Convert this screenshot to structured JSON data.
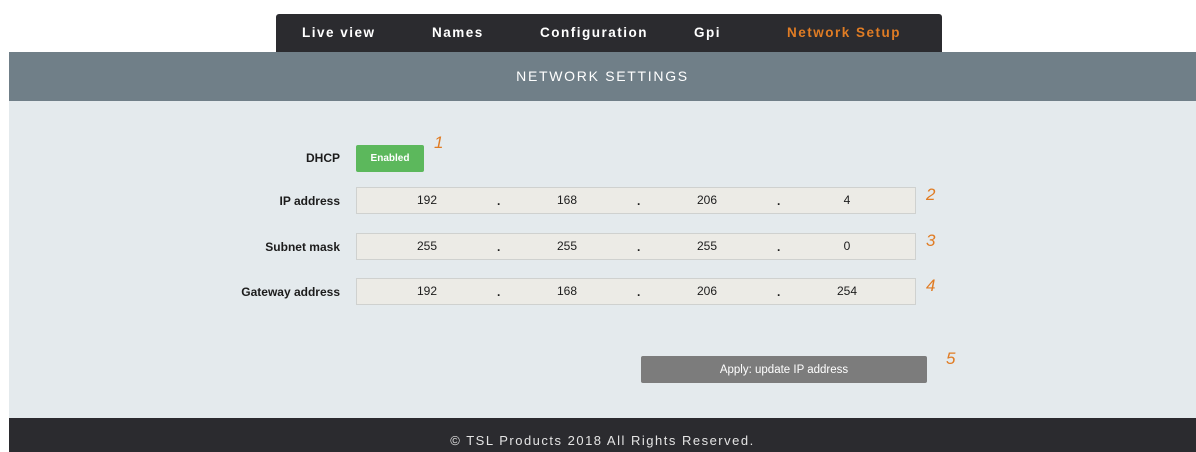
{
  "nav": {
    "tabs": [
      {
        "label": "Live view"
      },
      {
        "label": "Names"
      },
      {
        "label": "Configuration"
      },
      {
        "label": "Gpi"
      },
      {
        "label": "Network Setup"
      }
    ],
    "active_tab": "Network Setup"
  },
  "header": {
    "title": "NETWORK SETTINGS"
  },
  "form": {
    "dhcp": {
      "label": "DHCP",
      "button_label": "Enabled",
      "callout": "1"
    },
    "ip_address": {
      "label": "IP address",
      "octets": [
        "192",
        "168",
        "206",
        "4"
      ],
      "callout": "2"
    },
    "subnet_mask": {
      "label": "Subnet mask",
      "octets": [
        "255",
        "255",
        "255",
        "0"
      ],
      "callout": "3"
    },
    "gateway_address": {
      "label": "Gateway address",
      "octets": [
        "192",
        "168",
        "206",
        "254"
      ],
      "callout": "4"
    },
    "separator": ".",
    "apply": {
      "label": "Apply: update IP address",
      "callout": "5"
    }
  },
  "footer": {
    "text": "© TSL Products 2018 All Rights Reserved."
  },
  "colors": {
    "accent": "#e07c24",
    "header_bg": "#707f88",
    "content_bg": "#e4eaed",
    "nav_bg": "#2b2b2f",
    "enabled_green": "#5cb85c",
    "apply_gray": "#7c7c7c"
  }
}
